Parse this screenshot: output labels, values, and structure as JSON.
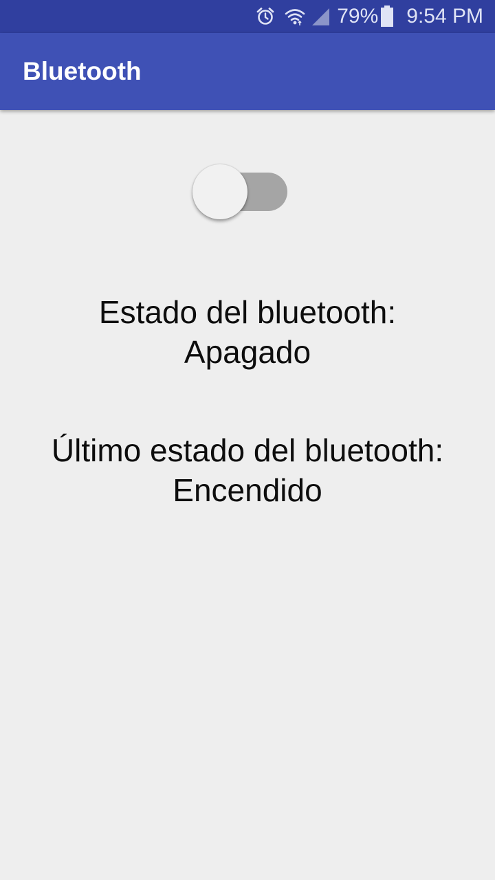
{
  "status_bar": {
    "icons": [
      "alarm-icon",
      "wifi-icon",
      "signal-icon",
      "battery-icon"
    ],
    "battery": "79%",
    "time": "9:54 PM"
  },
  "app_bar": {
    "title": "Bluetooth"
  },
  "bluetooth_switch": {
    "state": "off"
  },
  "status": {
    "label": "Estado del bluetooth:",
    "value": "Apagado"
  },
  "last_status": {
    "label": "Último estado del bluetooth:",
    "value": "Encendido"
  },
  "colors": {
    "status_bar": "#303f9f",
    "app_bar": "#3f51b5",
    "background": "#eeeeee",
    "switch_track_off": "#a5a5a5",
    "switch_thumb_off": "#f1f1f1"
  }
}
